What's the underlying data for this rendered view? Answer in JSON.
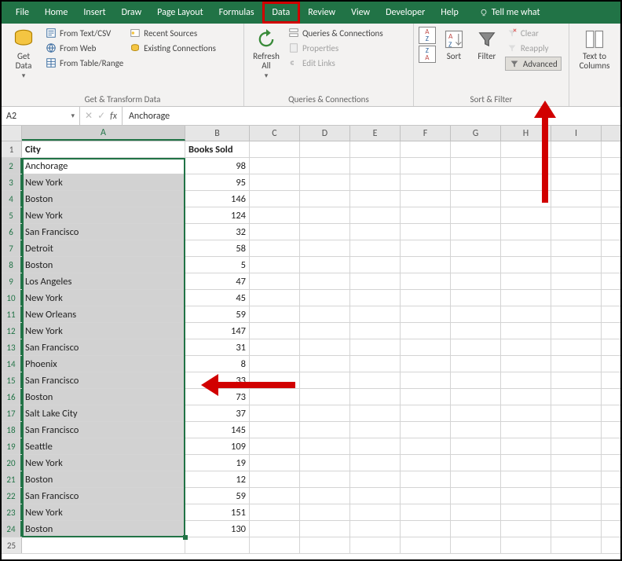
{
  "tabs": [
    "File",
    "Home",
    "Insert",
    "Draw",
    "Page Layout",
    "Formulas",
    "Data",
    "Review",
    "View",
    "Developer",
    "Help"
  ],
  "active_tab": "Data",
  "tell_me": "Tell me what",
  "ribbon": {
    "get_transform": {
      "get_data": "Get\nData",
      "from_text": "From Text/CSV",
      "from_web": "From Web",
      "from_table": "From Table/Range",
      "recent": "Recent Sources",
      "existing": "Existing Connections",
      "label": "Get & Transform Data"
    },
    "queries": {
      "refresh": "Refresh\nAll",
      "qc": "Queries & Connections",
      "props": "Properties",
      "edit": "Edit Links",
      "label": "Queries & Connections"
    },
    "sortfilter": {
      "sort": "Sort",
      "filter": "Filter",
      "clear": "Clear",
      "reapply": "Reapply",
      "advanced": "Advanced",
      "label": "Sort & Filter"
    },
    "datatools": {
      "texttocols": "Text to\nColumns"
    }
  },
  "namebox": "A2",
  "formula": "Anchorage",
  "columns": [
    "A",
    "B",
    "C",
    "D",
    "E",
    "F",
    "G",
    "H",
    "I"
  ],
  "headers": {
    "A": "City",
    "B": "Books Sold"
  },
  "rows": [
    {
      "n": 1,
      "A": "City",
      "B": "Books Sold",
      "hdr": true
    },
    {
      "n": 2,
      "A": "Anchorage",
      "B": "98",
      "active": true
    },
    {
      "n": 3,
      "A": "New York",
      "B": "95"
    },
    {
      "n": 4,
      "A": "Boston",
      "B": "146"
    },
    {
      "n": 5,
      "A": "New York",
      "B": "124"
    },
    {
      "n": 6,
      "A": "San Francisco",
      "B": "32"
    },
    {
      "n": 7,
      "A": "Detroit",
      "B": "58"
    },
    {
      "n": 8,
      "A": "Boston",
      "B": "5"
    },
    {
      "n": 9,
      "A": "Los Angeles",
      "B": "47"
    },
    {
      "n": 10,
      "A": "New York",
      "B": "45"
    },
    {
      "n": 11,
      "A": "New Orleans",
      "B": "59"
    },
    {
      "n": 12,
      "A": "New York",
      "B": "147"
    },
    {
      "n": 13,
      "A": "San Francisco",
      "B": "31"
    },
    {
      "n": 14,
      "A": "Phoenix",
      "B": "8"
    },
    {
      "n": 15,
      "A": "San Francisco",
      "B": "33"
    },
    {
      "n": 16,
      "A": "Boston",
      "B": "73"
    },
    {
      "n": 17,
      "A": "Salt Lake City",
      "B": "37"
    },
    {
      "n": 18,
      "A": "San Francisco",
      "B": "145"
    },
    {
      "n": 19,
      "A": "Seattle",
      "B": "109"
    },
    {
      "n": 20,
      "A": "New York",
      "B": "19"
    },
    {
      "n": 21,
      "A": "Boston",
      "B": "12"
    },
    {
      "n": 22,
      "A": "San Francisco",
      "B": "59"
    },
    {
      "n": 23,
      "A": "New York",
      "B": "151"
    },
    {
      "n": 24,
      "A": "Boston",
      "B": "130"
    },
    {
      "n": 25,
      "A": "",
      "B": ""
    }
  ]
}
